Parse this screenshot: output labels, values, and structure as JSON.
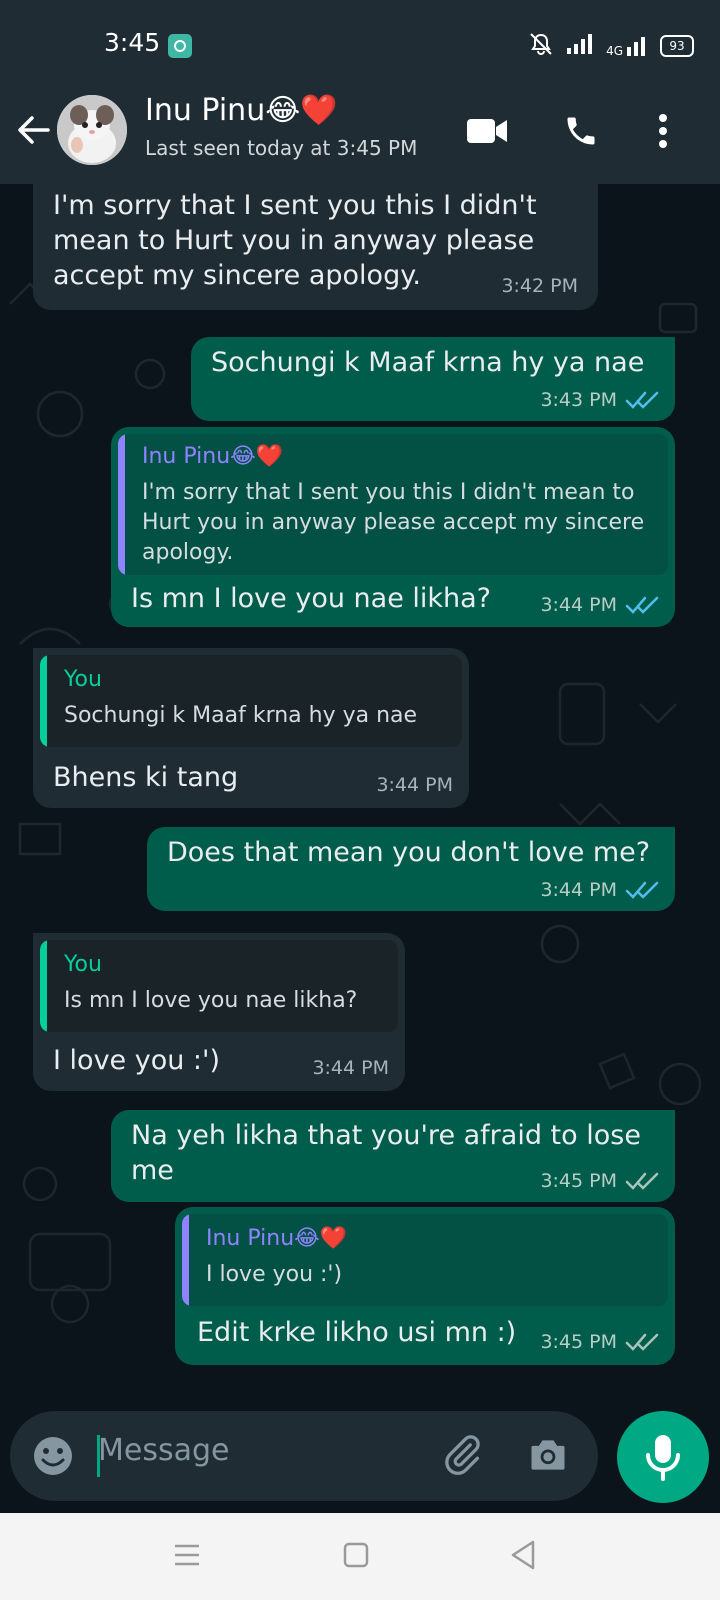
{
  "status": {
    "time": "3:45",
    "battery": "93",
    "network": "4G"
  },
  "header": {
    "contact_name": "Inu Pinu😂❤️",
    "last_seen": "Last seen today at 3:45 PM"
  },
  "messages": [
    {
      "direction": "incoming",
      "text": "I'm sorry that I sent you this I didn't mean to Hurt you in anyway please accept my sincere apology.",
      "time": "3:42 PM"
    },
    {
      "direction": "outgoing",
      "text": "Sochungi k Maaf krna hy ya nae",
      "time": "3:43 PM",
      "status": "read"
    },
    {
      "direction": "outgoing",
      "quote": {
        "name": "Inu Pinu😂❤️",
        "text": "I'm sorry that I sent you this I didn't mean to Hurt you in anyway please accept my sincere apology."
      },
      "text": "Is mn I love you nae likha?",
      "time": "3:44 PM",
      "status": "read"
    },
    {
      "direction": "incoming",
      "quote": {
        "name": "You",
        "text": "Sochungi k Maaf krna hy ya nae"
      },
      "text": "Bhens ki tang",
      "time": "3:44 PM"
    },
    {
      "direction": "outgoing",
      "text": "Does that mean you don't love me?",
      "time": "3:44 PM",
      "status": "read"
    },
    {
      "direction": "incoming",
      "quote": {
        "name": "You",
        "text": "Is mn I love you nae likha?"
      },
      "text": "I love you :')",
      "time": "3:44 PM"
    },
    {
      "direction": "outgoing",
      "text": "Na yeh likha that you're afraid to lose me",
      "time": "3:45 PM",
      "status": "delivered"
    },
    {
      "direction": "outgoing",
      "quote": {
        "name": "Inu Pinu😂❤️",
        "text": "I love you :')"
      },
      "text": "Edit krke likho usi mn :)",
      "time": "3:45 PM",
      "status": "delivered"
    }
  ],
  "composer": {
    "placeholder": "Message"
  },
  "colors": {
    "accent": "#00a884",
    "incoming_bubble": "#1f2c34",
    "outgoing_bubble": "#005c4b",
    "read_ticks": "#53bdeb",
    "quote_name_contact": "#8f83ff",
    "quote_name_you": "#06cf9c"
  }
}
